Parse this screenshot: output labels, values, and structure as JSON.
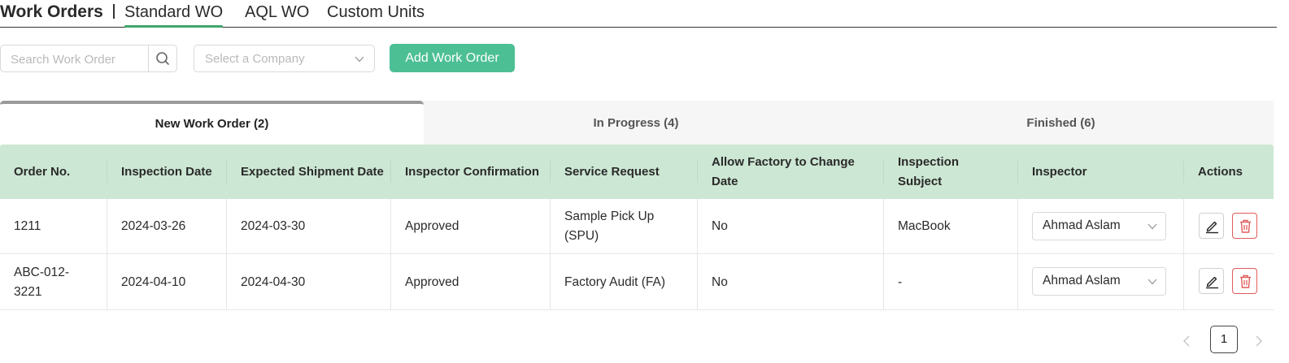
{
  "header": {
    "title": "Work Orders",
    "tabs": [
      {
        "label": "Standard WO"
      },
      {
        "label": "AQL WO"
      },
      {
        "label": "Custom Units"
      }
    ]
  },
  "toolbar": {
    "search_placeholder": "Search Work Order",
    "company_placeholder": "Select a Company",
    "add_label": "Add Work Order"
  },
  "status_tabs": [
    {
      "label": "New Work Order (2)"
    },
    {
      "label": "In Progress (4)"
    },
    {
      "label": "Finished (6)"
    }
  ],
  "table": {
    "columns": [
      "Order No.",
      "Inspection Date",
      "Expected Shipment Date",
      "Inspector Confirmation",
      "Service Request",
      "Allow Factory to Change Date",
      "Inspection Subject",
      "Inspector",
      "Actions"
    ],
    "rows": [
      {
        "order_no": "1211",
        "inspection_date": "2024-03-26",
        "shipment_date": "2024-03-30",
        "confirmation": "Approved",
        "service": "Sample Pick Up (SPU)",
        "allow_change": "No",
        "subject": "MacBook",
        "inspector": "Ahmad Aslam"
      },
      {
        "order_no": "ABC-012-3221",
        "inspection_date": "2024-04-10",
        "shipment_date": "2024-04-30",
        "confirmation": "Approved",
        "service": "Factory Audit (FA)",
        "allow_change": "No",
        "subject": "-",
        "inspector": "Ahmad Aslam"
      }
    ]
  },
  "pagination": {
    "current": "1"
  },
  "colors": {
    "accent": "#3fa56a",
    "button": "#4cbf95",
    "header_bg": "#cce7d3",
    "delete": "#e05b5b"
  },
  "icons": [
    "search-icon",
    "chevron-down-icon",
    "edit-icon",
    "trash-icon",
    "chevron-left-icon",
    "chevron-right-icon"
  ]
}
